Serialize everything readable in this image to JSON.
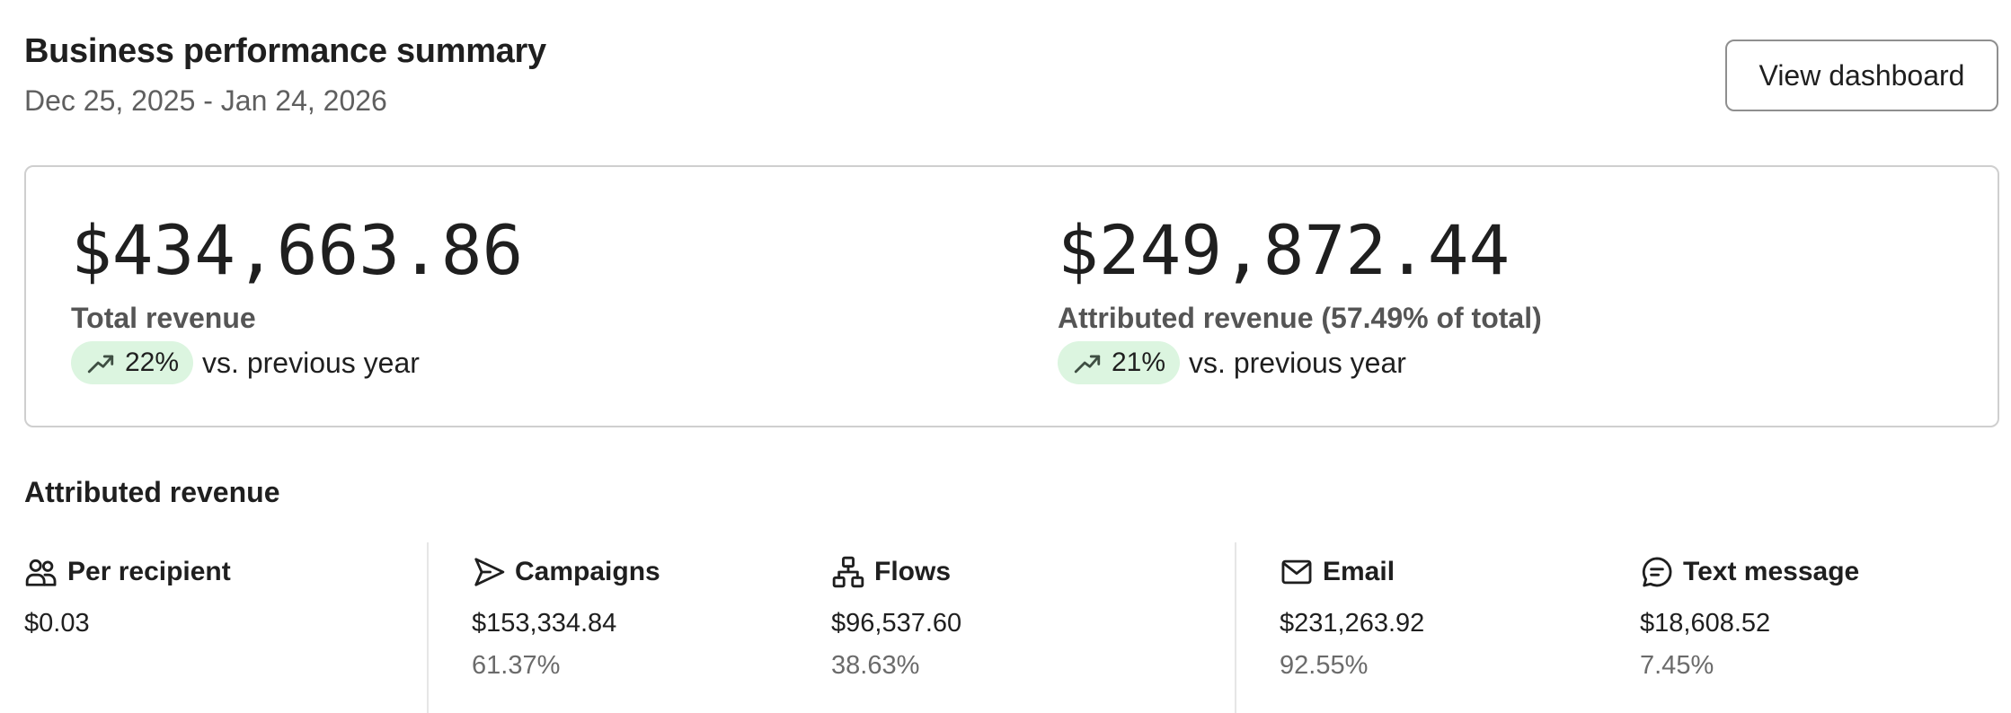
{
  "header": {
    "title": "Business performance summary",
    "date_range": "Dec 25, 2025 - Jan 24, 2026",
    "view_button": "View dashboard"
  },
  "summary": {
    "total": {
      "value": "$434,663.86",
      "label": "Total revenue",
      "change": "22%",
      "comparison": "vs. previous year",
      "trend_icon": "trending-up-icon"
    },
    "attributed": {
      "value": "$249,872.44",
      "label": "Attributed revenue (57.49% of total)",
      "change": "21%",
      "comparison": "vs. previous year",
      "trend_icon": "trending-up-icon"
    },
    "pill_color": "#dcf5e0"
  },
  "attributed_section": {
    "title": "Attributed revenue",
    "columns": [
      {
        "label": "Per recipient",
        "icon": "users-icon",
        "value": "$0.03",
        "percent": ""
      },
      {
        "label": "Campaigns",
        "icon": "send-icon",
        "value": "$153,334.84",
        "percent": "61.37%"
      },
      {
        "label": "Flows",
        "icon": "flow-icon",
        "value": "$96,537.60",
        "percent": "38.63%"
      },
      {
        "label": "Email",
        "icon": "mail-icon",
        "value": "$231,263.92",
        "percent": "92.55%"
      },
      {
        "label": "Text message",
        "icon": "message-icon",
        "value": "$18,608.52",
        "percent": "7.45%"
      }
    ]
  }
}
